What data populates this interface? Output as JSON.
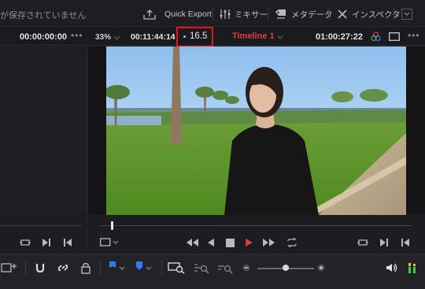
{
  "topbar": {
    "unsaved_text": "が保存されていません",
    "quick_export_label": "Quick Export",
    "mixer_label": "ミキサー",
    "metadata_label": "メタデータ",
    "inspector_label": "インスペクタ"
  },
  "statusbar": {
    "source_timecode": "00:00:00:00",
    "zoom_level": "33%",
    "duration": "00:11:44:14",
    "frame_rate": "16.5",
    "timeline_name": "Timeline 1",
    "record_timecode": "01:00:27:22"
  },
  "playback": {
    "playhead_position": 0.04
  },
  "bottombar": {
    "zoom_slider_value": 0.5
  },
  "colors": {
    "accent_red": "#e23b3b",
    "highlight_box": "#e5141b",
    "flag_blue": "#2f7bff",
    "meter_green": "#3fcf3f",
    "meter_yellow": "#e6c229"
  }
}
